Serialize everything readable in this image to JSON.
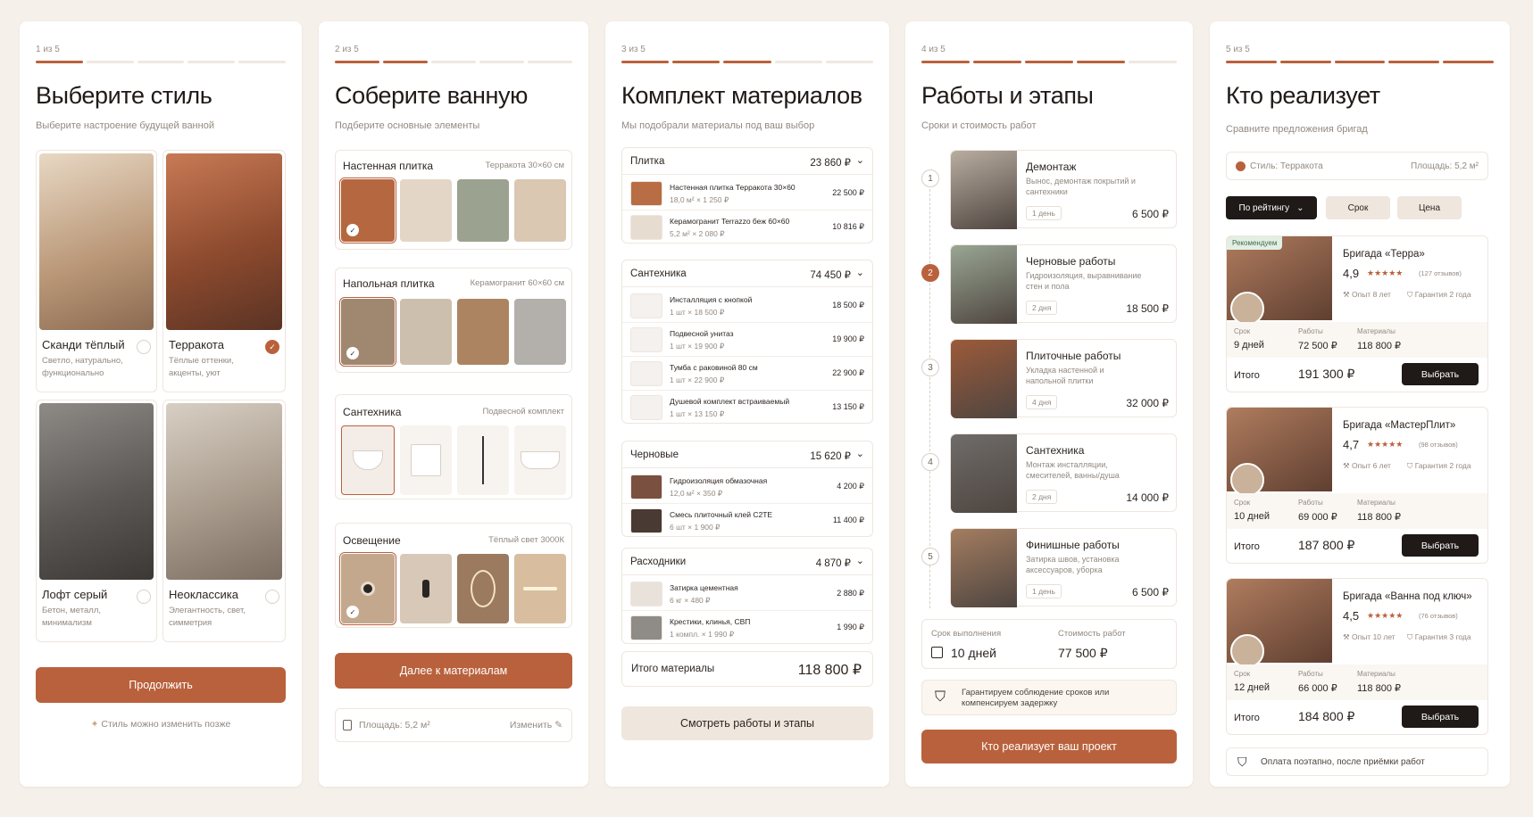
{
  "s1": {
    "step": "1 из 5",
    "title": "Выберите стиль",
    "subtitle": "Выберите настроение будущей ванной",
    "styles": [
      {
        "name": "Сканди тёплый",
        "desc": "Светло, натурально, функционально"
      },
      {
        "name": "Терракота",
        "desc": "Тёплые оттенки, акценты, уют"
      },
      {
        "name": "Лофт серый",
        "desc": "Бетон, металл, минимализм"
      },
      {
        "name": "Неоклассика",
        "desc": "Элегантность, свет, симметрия"
      }
    ],
    "selected": 1,
    "cta": "Продолжить",
    "hint": "Стиль можно изменить позже"
  },
  "s2": {
    "step": "2 из 5",
    "title": "Соберите ванную",
    "subtitle": "Подберите основные элементы",
    "sections": [
      {
        "label": "Настенная плитка",
        "spec": "Терракота 30×60 см"
      },
      {
        "label": "Напольная плитка",
        "spec": "Керамогранит 60×60 см"
      },
      {
        "label": "Сантехника",
        "spec": "Подвесной комплект"
      },
      {
        "label": "Освещение",
        "spec": "Тёплый свет 3000К"
      }
    ],
    "cta": "Далее к материалам",
    "area": "Площадь: 5,2 м²",
    "change": "Изменить"
  },
  "s3": {
    "step": "3 из 5",
    "title": "Комплект материалов",
    "subtitle": "Мы подобрали материалы под ваш выбор",
    "groups": [
      {
        "name": "Плитка",
        "total": "23 860 ₽",
        "items": [
          {
            "name": "Настенная плитка Терракота 30×60",
            "qty": "18,0 м² × 1 250 ₽",
            "price": "22 500 ₽"
          },
          {
            "name": "Керамогранит Terrazzo беж 60×60",
            "qty": "5,2 м² × 2 080 ₽",
            "price": "10 816 ₽"
          }
        ]
      },
      {
        "name": "Сантехника",
        "total": "74 450 ₽",
        "items": [
          {
            "name": "Инсталляция с кнопкой",
            "qty": "1 шт × 18 500 ₽",
            "price": "18 500 ₽"
          },
          {
            "name": "Подвесной унитаз",
            "qty": "1 шт × 19 900 ₽",
            "price": "19 900 ₽"
          },
          {
            "name": "Тумба с раковиной 80 см",
            "qty": "1 шт × 22 900 ₽",
            "price": "22 900 ₽"
          },
          {
            "name": "Душевой комплект встраиваемый",
            "qty": "1 шт × 13 150 ₽",
            "price": "13 150 ₽"
          }
        ]
      },
      {
        "name": "Черновые",
        "total": "15 620 ₽",
        "items": [
          {
            "name": "Гидроизоляция обмазочная",
            "qty": "12,0 м² × 350 ₽",
            "price": "4 200 ₽"
          },
          {
            "name": "Смесь плиточный клей C2TE",
            "qty": "6 шт × 1 900 ₽",
            "price": "11 400 ₽"
          }
        ]
      },
      {
        "name": "Расходники",
        "total": "4 870 ₽",
        "items": [
          {
            "name": "Затирка цементная",
            "qty": "6 кг × 480 ₽",
            "price": "2 880 ₽"
          },
          {
            "name": "Крестики, клинья, СВП",
            "qty": "1 компл. × 1 990 ₽",
            "price": "1 990 ₽"
          }
        ]
      }
    ],
    "total_label": "Итого материалы",
    "total": "118 800 ₽",
    "cta": "Смотреть работы и этапы"
  },
  "s4": {
    "step": "4 из 5",
    "title": "Работы и этапы",
    "subtitle": "Сроки и стоимость работ",
    "stages": [
      {
        "n": "1",
        "name": "Демонтаж",
        "desc": "Вынос, демонтаж покрытий и сантехники",
        "dur": "1 день",
        "price": "6 500 ₽"
      },
      {
        "n": "2",
        "name": "Черновые работы",
        "desc": "Гидроизоляция, выравнивание стен и пола",
        "dur": "2 дня",
        "price": "18 500 ₽"
      },
      {
        "n": "3",
        "name": "Плиточные работы",
        "desc": "Укладка настенной и напольной плитки",
        "dur": "4 дня",
        "price": "32 000 ₽"
      },
      {
        "n": "4",
        "name": "Сантехника",
        "desc": "Монтаж инсталляции, смесителей, ванны/душа",
        "dur": "2 дня",
        "price": "14 000 ₽"
      },
      {
        "n": "5",
        "name": "Финишные работы",
        "desc": "Затирка швов, установка аксессуаров, уборка",
        "dur": "1 день",
        "price": "6 500 ₽"
      }
    ],
    "term_label": "Срок выполнения",
    "term": "10 дней",
    "cost_label": "Стоимость работ",
    "cost": "77 500 ₽",
    "guarantee": "Гарантируем соблюдение сроков или компенсируем задержку",
    "cta": "Кто реализует ваш проект"
  },
  "s5": {
    "step": "5 из 5",
    "title": "Кто реализует",
    "subtitle": "Сравните предложения бригад",
    "style": "Стиль: Терракота",
    "area": "Площадь: 5,2 м²",
    "sort": [
      "По рейтингу",
      "Срок",
      "Цена"
    ],
    "recommend": "Рекомендуем",
    "labels": {
      "term": "Срок",
      "works": "Работы",
      "materials": "Материалы",
      "total": "Итого",
      "choose": "Выбрать"
    },
    "teams": [
      {
        "name": "Бригада «Терра»",
        "rating": "4,9",
        "stars": "★★★★★",
        "reviews": "(127 отзывов)",
        "exp": "Опыт 8 лет",
        "guar": "Гарантия 2 года",
        "term": "9 дней",
        "works": "72 500 ₽",
        "mats": "118 800 ₽",
        "total": "191 300 ₽"
      },
      {
        "name": "Бригада «МастерПлит»",
        "rating": "4,7",
        "stars": "★★★★★",
        "reviews": "(98 отзывов)",
        "exp": "Опыт 6 лет",
        "guar": "Гарантия 2 года",
        "term": "10 дней",
        "works": "69 000 ₽",
        "mats": "118 800 ₽",
        "total": "187 800 ₽"
      },
      {
        "name": "Бригада «Ванна под ключ»",
        "rating": "4,5",
        "stars": "★★★★★",
        "reviews": "(76 отзывов)",
        "exp": "Опыт 10 лет",
        "guar": "Гарантия 3 года",
        "term": "12 дней",
        "works": "66 000 ₽",
        "mats": "118 800 ₽",
        "total": "184 800 ₽"
      }
    ],
    "footer": "Оплата поэтапно, после приёмки работ"
  },
  "colors": {
    "accent": "#b9613c",
    "dark": "#1f1a17",
    "bg": "#f5f0ea"
  }
}
